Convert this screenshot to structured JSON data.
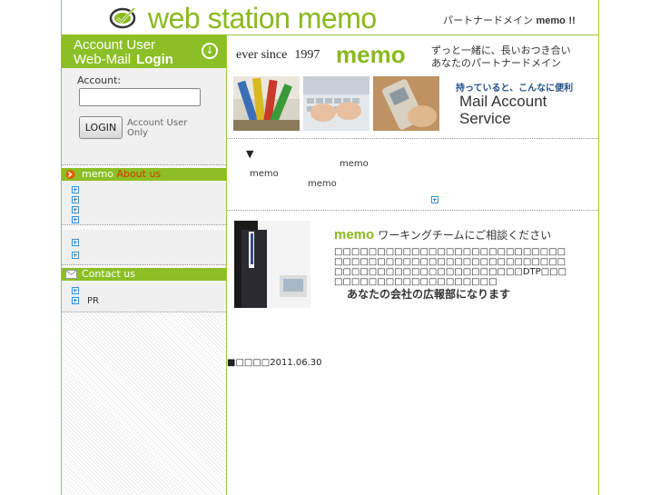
{
  "header": {
    "logo_text": "web station memo",
    "tagline_jp": "パートナードメイン",
    "tagline_memo": "memo",
    "tagline_end": "!!"
  },
  "sidebar": {
    "login": {
      "title1": "Account User",
      "title2_a": "Web-Mail",
      "title2_b": "Login",
      "account_label": "Account:",
      "account_value": "",
      "login_button": "LOGIN",
      "note": "Account User Only"
    },
    "about": {
      "prefix": "memo",
      "label": "About us"
    },
    "contact": {
      "label": "Contact us",
      "pr_label": "PR"
    }
  },
  "main": {
    "banner": {
      "since": "ever since",
      "year": "1997",
      "memo": "memo",
      "jp_line1": "ずっと一緒に、長いおつき合い",
      "jp_line2": "あなたのパートナードメイン",
      "mail_jp": "持っていると、こんなに便利",
      "mail_title1": "Mail Account",
      "mail_title2": "Service"
    },
    "news": {
      "marker": "▼",
      "item1": "memo",
      "item2": "memo",
      "item3": "memo"
    },
    "consult": {
      "memo": "memo",
      "title": "ワーキングチームにご相談ください",
      "body": "□□□□□□□□□□□□□□□□□□□□□□□□□□□□□□□□□□□□□□□□□□□□□□□□□□□□□□□□□□□□□□□□□□□□□□□□□□□□DTP□□□□□□□□□□□□□□□□□□□□□□",
      "tagline": "あなたの会社の広報部になります"
    },
    "date": "■□□□□2011.06.30"
  }
}
